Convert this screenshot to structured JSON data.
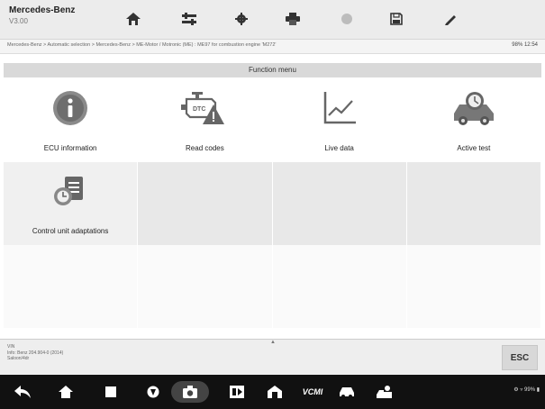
{
  "header": {
    "vehicle": "Mercedes-Benz",
    "version": "V3.00",
    "toolbar_icons": [
      "home-icon",
      "vehicle-swap-icon",
      "settings-icon",
      "print-icon",
      "help-icon",
      "save-icon",
      "data-logging-icon"
    ]
  },
  "breadcrumb": {
    "path": "Mercedes-Benz > Automatic selection > Mercedes-Benz > ME-Motor / Motronic (ME) : ME97 for combustion engine 'M272'",
    "status": "98%  12:54"
  },
  "function_menu": {
    "title": "Function menu",
    "items": [
      {
        "label": "ECU information",
        "icon": "info-icon"
      },
      {
        "label": "Read codes",
        "icon": "dtc-engine-icon"
      },
      {
        "label": "Live data",
        "icon": "line-graph-icon"
      },
      {
        "label": "Active test",
        "icon": "car-test-icon"
      },
      {
        "label": "Control unit adaptations",
        "icon": "adaptation-icon"
      }
    ]
  },
  "footer": {
    "info_lines": [
      "VIN",
      "Info: Benz 204.904-0 (2014)",
      "Saloon/4dr"
    ],
    "esc_label": "ESC"
  },
  "navbar": {
    "items": [
      "back-icon",
      "home-icon",
      "recent-apps-icon",
      "browser-icon",
      "camera-icon",
      "screen-record-icon",
      "maxi-home-icon",
      "vci-icon",
      "car-icon",
      "technician-icon"
    ],
    "vci_label": "VCMI",
    "status": "⚙ ▿ 99% ▮"
  }
}
